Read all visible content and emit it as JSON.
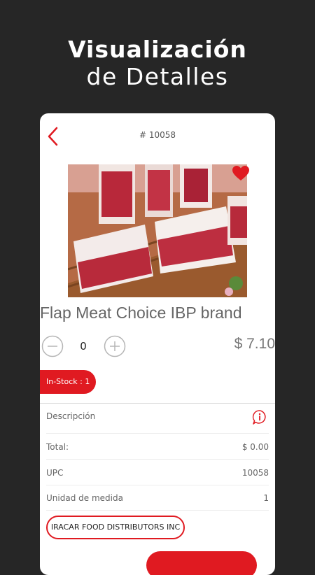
{
  "headline": {
    "line1": "Visualización",
    "line2": "de Detalles"
  },
  "product": {
    "order_number": "# 10058",
    "title": "Flap Meat Choice IBP brand",
    "quantity": "0",
    "price": "$ 7.10",
    "stock_label": "In-Stock :  1",
    "description_label": "Descripción",
    "distributor": "IRACAR FOOD DISTRIBUTORS INC",
    "favorite": true
  },
  "details": [
    {
      "label": "Total:",
      "value": "$  0.00"
    },
    {
      "label": "UPC",
      "value": "10058"
    },
    {
      "label": "Unidad de medida",
      "value": "1"
    }
  ],
  "colors": {
    "accent": "#e01a21",
    "background": "#262626",
    "card": "#ffffff"
  },
  "icons": [
    "back-arrow-icon",
    "heart-icon",
    "minus-circle-icon",
    "plus-circle-icon",
    "info-icon"
  ]
}
